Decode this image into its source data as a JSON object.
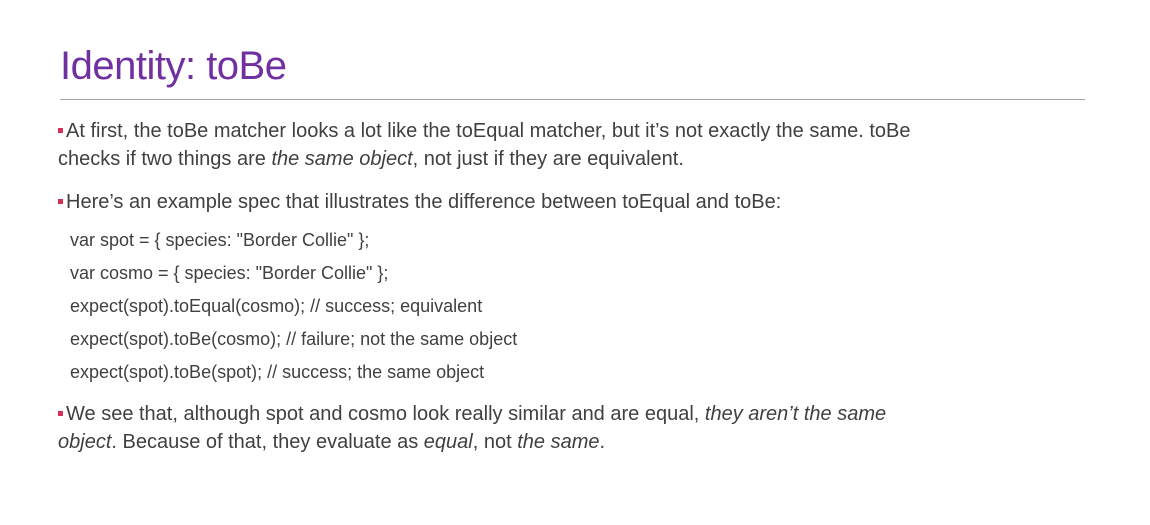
{
  "slide": {
    "title": "Identity: toBe",
    "bullets": [
      {
        "line1": "At first, the toBe matcher looks a lot like the toEqual matcher, but it’s not exactly the same. toBe",
        "line2_pre": "checks if two things are ",
        "line2_em": "the same object",
        "line2_post": ", not just if they are equivalent."
      },
      {
        "line1": "Here’s an example spec that illustrates the difference between toEqual and toBe:"
      },
      {
        "line1_pre": "We see that, although spot and cosmo look really similar and are equal, ",
        "line1_em": "they aren’t the same",
        "line2_em1": "object",
        "line2_mid": ". Because of that, they evaluate as ",
        "line2_em2": "equal",
        "line2_mid2": ", not ",
        "line2_em3": "the same",
        "line2_post": "."
      }
    ],
    "code": [
      "var spot = { species: \"Border Collie\" };",
      "var cosmo = { species: \"Border Collie\" };",
      "expect(spot).toEqual(cosmo); // success; equivalent",
      "expect(spot).toBe(cosmo); // failure; not the same object",
      "expect(spot).toBe(spot); // success; the same object"
    ]
  },
  "colors": {
    "title": "#7030a0",
    "bullet": "#d0305a",
    "text": "#404040",
    "rule": "#a6a6a6"
  }
}
